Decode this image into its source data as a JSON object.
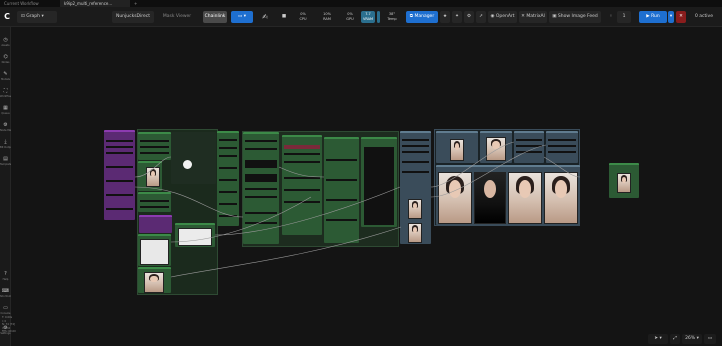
{
  "tabs": [
    {
      "label": "Current Workflow"
    },
    {
      "label": "k9ip2_multi_reference..."
    }
  ],
  "topbar": {
    "graph_label": "Graph",
    "extension_a": "NunjucksDirect",
    "extension_b": "Mask Viewer",
    "chainlink_label": "Chainlink",
    "stats": [
      {
        "value": "0%",
        "label": "CPU"
      },
      {
        "value": "10%",
        "label": "RAM"
      },
      {
        "value": "0%",
        "label": "GPU"
      },
      {
        "value": "7.7",
        "label": "VRAM"
      },
      {
        "value": "38°",
        "label": "Temp"
      }
    ],
    "manager_label": "Manager",
    "openart_label": "OpenArt",
    "matrixai_label": "MatrixAI",
    "show_feed_label": "Show Image Feed",
    "queue_count": "1",
    "run_label": "Run",
    "active_label": "0 active"
  },
  "sidebar": {
    "items": [
      {
        "icon": "◷",
        "label": "Assets"
      },
      {
        "icon": "⌬",
        "label": "Nodes"
      },
      {
        "icon": "✎",
        "label": "Models"
      },
      {
        "icon": "⛶",
        "label": "Workflows"
      },
      {
        "icon": "▦",
        "label": "Queue"
      },
      {
        "icon": "⚙",
        "label": "Node Map"
      },
      {
        "icon": "⤓",
        "label": "Bit Outputs"
      },
      {
        "icon": "▤",
        "label": "Templates"
      }
    ],
    "bottom_items": [
      {
        "icon": "?",
        "label": "Help"
      },
      {
        "icon": "⌨",
        "label": "Shortcuts"
      },
      {
        "icon": "▭",
        "label": "Console"
      },
      {
        "icon": "⚙",
        "label": "Settings"
      }
    ]
  },
  "status_lines": [
    "T: 0.00s",
    "I: 0",
    "N: 74 [74]",
    "V: 132",
    "FPS: 60.00"
  ],
  "zoom": "26%",
  "colors": {
    "background": "#141414",
    "node_green": "#2c5a34",
    "node_purple": "#5b2a73",
    "node_slate": "#3a4c5a",
    "accent_blue": "#1e6fd0",
    "run_red": "#8a1d1d"
  }
}
